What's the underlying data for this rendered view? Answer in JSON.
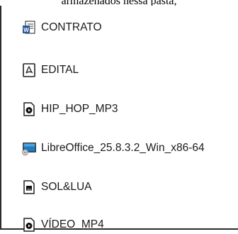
{
  "top_text": "armazenados nessa pasta,",
  "files": [
    {
      "name": "CONTRATO",
      "icon": "word-document-icon"
    },
    {
      "name": "EDITAL",
      "icon": "pdf-document-icon"
    },
    {
      "name": "HIP_HOP_MP3",
      "icon": "media-file-icon"
    },
    {
      "name": "LibreOffice_25.8.3.2_Win_x86-64",
      "icon": "installer-package-icon"
    },
    {
      "name": "SOL&LUA",
      "icon": "image-file-icon"
    },
    {
      "name": "VÍDEO_MP4",
      "icon": "media-file-icon"
    }
  ],
  "colors": {
    "word_blue": "#2b579a",
    "pdf_red": "#222222",
    "installer_blue": "#1f7bbf"
  }
}
